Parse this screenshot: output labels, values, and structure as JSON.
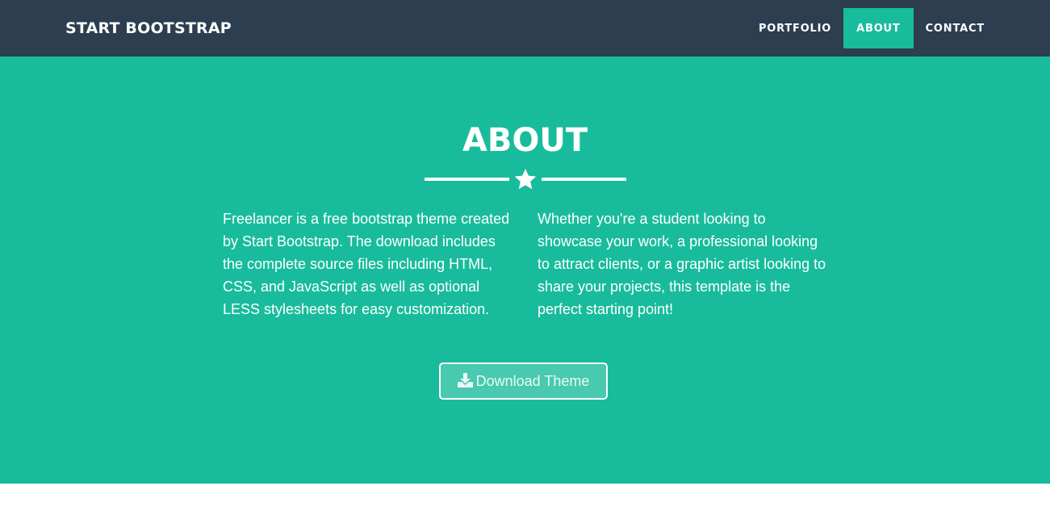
{
  "navbar": {
    "brand": "START BOOTSTRAP",
    "items": [
      {
        "label": "PORTFOLIO",
        "active": false
      },
      {
        "label": "ABOUT",
        "active": true
      },
      {
        "label": "CONTACT",
        "active": false
      }
    ]
  },
  "about": {
    "title": "ABOUT",
    "divider_icon": "star-icon",
    "left_text": "Freelancer is a free bootstrap theme created by Start Bootstrap. The download includes the complete source files including HTML, CSS, and JavaScript as well as optional LESS stylesheets for easy customization.",
    "right_text": "Whether you're a student looking to showcase your work, a professional looking to attract clients, or a graphic artist looking to share your projects, this template is the perfect starting point!",
    "download_label": "Download Theme",
    "download_icon": "download-icon"
  },
  "colors": {
    "navbar_bg": "#2c3e50",
    "accent": "#18bc9c",
    "text": "#ffffff"
  }
}
